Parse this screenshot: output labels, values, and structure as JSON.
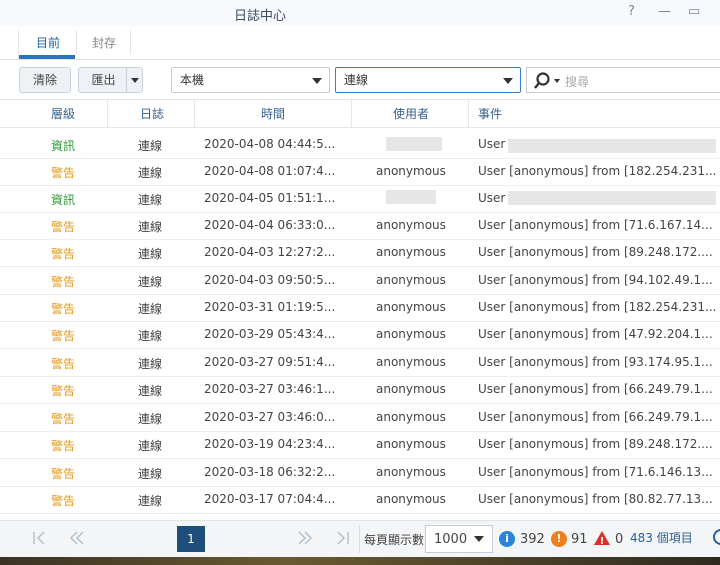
{
  "window": {
    "title": "日誌中心",
    "help": "?",
    "minimize": "—",
    "maximize": "▭"
  },
  "tabs": [
    {
      "label": "目前"
    },
    {
      "label": "封存"
    }
  ],
  "toolbar": {
    "clear": "清除",
    "export": "匯出",
    "source": "本機",
    "type": "連線",
    "search_placeholder": "搜尋"
  },
  "columns": [
    "層級",
    "日誌",
    "時間",
    "使用者",
    "事件"
  ],
  "rows": [
    {
      "level": "資訊",
      "log": "連線",
      "time": "2020-04-08 04:44:5...",
      "user": "",
      "event": "User"
    },
    {
      "level": "警告",
      "log": "連線",
      "time": "2020-04-08 01:07:4...",
      "user": "anonymous",
      "event": "User [anonymous] from [182.254.231..."
    },
    {
      "level": "資訊",
      "log": "連線",
      "time": "2020-04-05 01:51:1...",
      "user": "",
      "event": "User"
    },
    {
      "level": "警告",
      "log": "連線",
      "time": "2020-04-04 06:33:0...",
      "user": "anonymous",
      "event": "User [anonymous] from [71.6.167.14..."
    },
    {
      "level": "警告",
      "log": "連線",
      "time": "2020-04-03 12:27:2...",
      "user": "anonymous",
      "event": "User [anonymous] from [89.248.172...."
    },
    {
      "level": "警告",
      "log": "連線",
      "time": "2020-04-03 09:50:5...",
      "user": "anonymous",
      "event": "User [anonymous] from [94.102.49.1..."
    },
    {
      "level": "警告",
      "log": "連線",
      "time": "2020-03-31 01:19:5...",
      "user": "anonymous",
      "event": "User [anonymous] from [182.254.231..."
    },
    {
      "level": "警告",
      "log": "連線",
      "time": "2020-03-29 05:43:4...",
      "user": "anonymous",
      "event": "User [anonymous] from [47.92.204.1..."
    },
    {
      "level": "警告",
      "log": "連線",
      "time": "2020-03-27 09:51:4...",
      "user": "anonymous",
      "event": "User [anonymous] from [93.174.95.1..."
    },
    {
      "level": "警告",
      "log": "連線",
      "time": "2020-03-27 03:46:1...",
      "user": "anonymous",
      "event": "User [anonymous] from [66.249.79.1..."
    },
    {
      "level": "警告",
      "log": "連線",
      "time": "2020-03-27 03:46:0...",
      "user": "anonymous",
      "event": "User [anonymous] from [66.249.79.1..."
    },
    {
      "level": "警告",
      "log": "連線",
      "time": "2020-03-19 04:23:4...",
      "user": "anonymous",
      "event": "User [anonymous] from [89.248.172...."
    },
    {
      "level": "警告",
      "log": "連線",
      "time": "2020-03-18 06:32:2...",
      "user": "anonymous",
      "event": "User [anonymous] from [71.6.146.13..."
    },
    {
      "level": "警告",
      "log": "連線",
      "time": "2020-03-17 07:04:4...",
      "user": "anonymous",
      "event": "User [anonymous] from [80.82.77.13..."
    }
  ],
  "footer": {
    "page": "1",
    "per_page_label": "每頁顯示數",
    "per_page": "1000",
    "info_count": "392",
    "warn_count": "91",
    "error_count": "0",
    "total": "483 個項目"
  },
  "colors": {
    "info": "#2f9a3b",
    "warning": "#e59a1c",
    "error": "#d93025",
    "accent": "#1f4e7a"
  }
}
